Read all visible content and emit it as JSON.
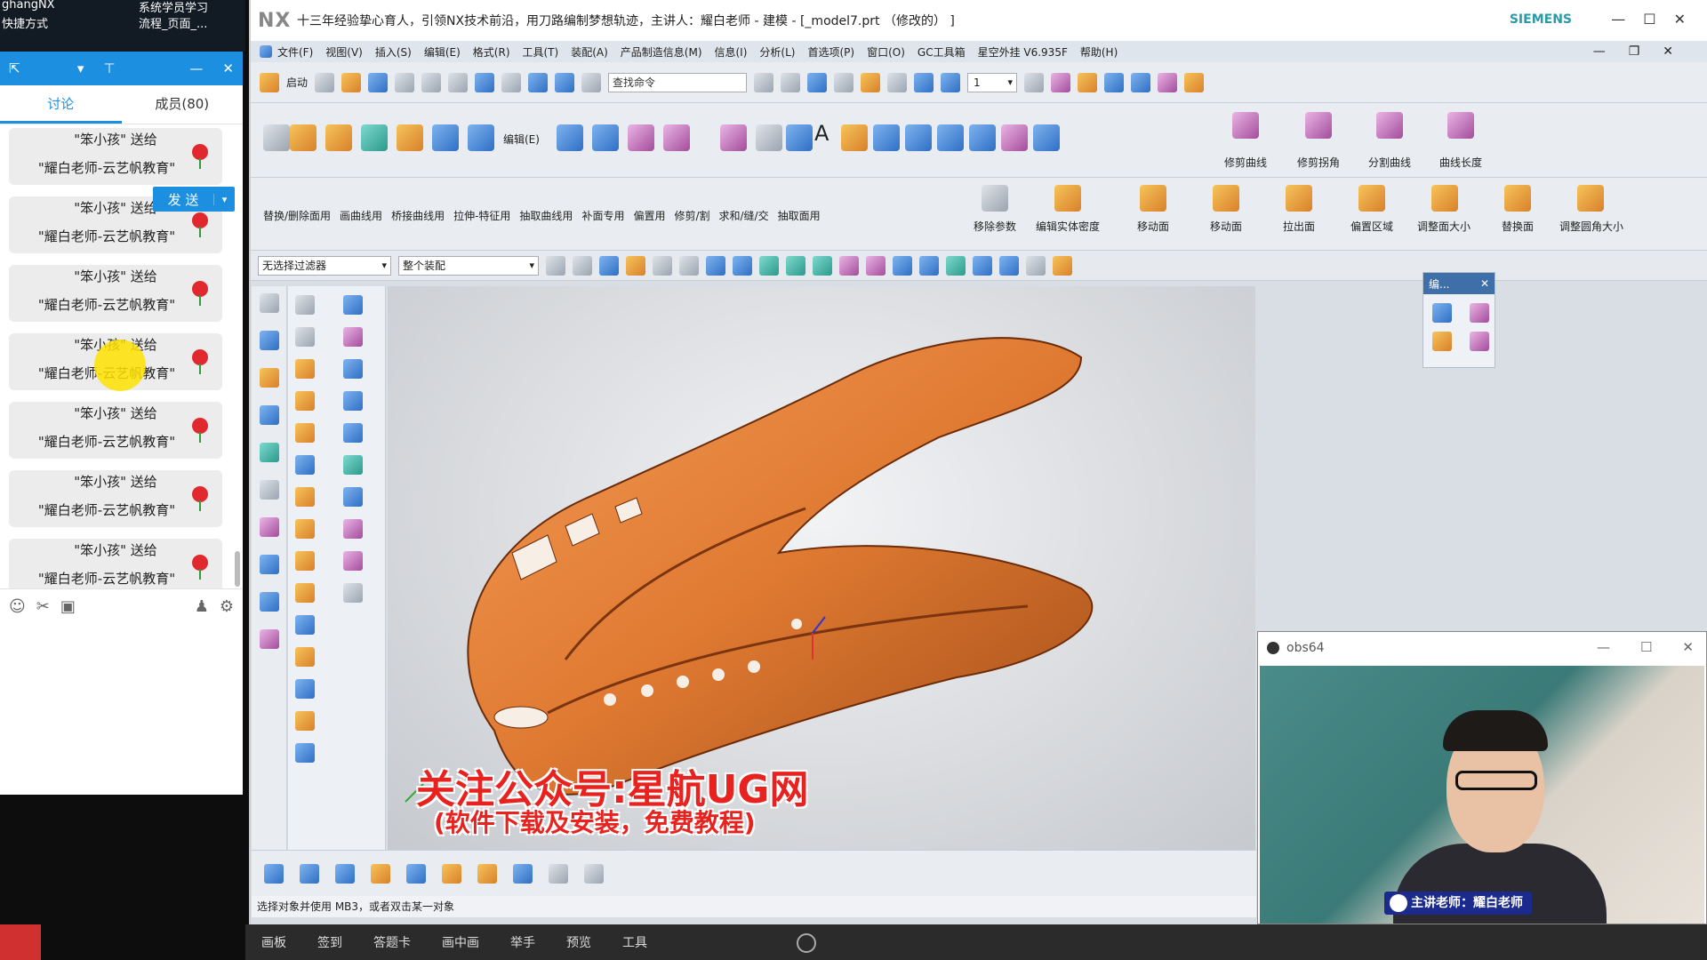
{
  "desktop": {
    "left_top": "ghangNX",
    "left_sub": "快捷方式",
    "right_top": "系统学员学习",
    "right_sub": "流程_页面_..."
  },
  "chat": {
    "tabs": [
      {
        "label": "讨论"
      },
      {
        "label": "成员(80)"
      }
    ],
    "messages": [
      {
        "line1": "\"笨小孩\" 送给",
        "line2": "\"耀白老师-云艺帆教育\""
      },
      {
        "line1": "\"笨小孩\" 送给",
        "line2": "\"耀白老师-云艺帆教育\""
      },
      {
        "line1": "\"笨小孩\" 送给",
        "line2": "\"耀白老师-云艺帆教育\""
      },
      {
        "line1": "\"笨小孩\" 送给",
        "line2": "\"耀白老师-云艺帆教育\""
      },
      {
        "line1": "\"笨小孩\" 送给",
        "line2": "\"耀白老师-云艺帆教育\""
      },
      {
        "line1": "\"笨小孩\" 送给",
        "line2": "\"耀白老师-云艺帆教育\""
      },
      {
        "line1": "\"笨小孩\" 送给",
        "line2": "\"耀白老师-云艺帆教育\""
      }
    ],
    "send": "发 送"
  },
  "nx": {
    "logo": "NX",
    "title": "十三年经验挚心育人，引领NX技术前沿，用刀路编制梦想轨迹，主讲人：耀白老师 - 建模 - [_model7.prt （修改的） ]",
    "brand": "SIEMENS",
    "menu": [
      "文件(F)",
      "视图(V)",
      "插入(S)",
      "编辑(E)",
      "格式(R)",
      "工具(T)",
      "装配(A)",
      "产品制造信息(M)",
      "信息(I)",
      "分析(L)",
      "首选项(P)",
      "窗口(O)",
      "GC工具箱",
      "星空外挂 V6.935F",
      "帮助(H)"
    ],
    "start_label": "启动",
    "search_placeholder": "查找命令",
    "layer_value": "1",
    "edit_label": "编辑(E)",
    "ribbon_right": [
      {
        "label": "修剪曲线"
      },
      {
        "label": "修剪拐角"
      },
      {
        "label": "分割曲线"
      },
      {
        "label": "曲线长度"
      }
    ],
    "row3_left": [
      "替换/删除面用",
      "画曲线用",
      "桥接曲线用",
      "拉伸-特征用",
      "抽取曲线用",
      "补面专用",
      "偏置用",
      "修剪/割",
      "求和/缝/交",
      "抽取面用"
    ],
    "row3_right": [
      {
        "label": "移除参数"
      },
      {
        "label": "编辑实体密度"
      },
      {
        "label": "移动面"
      },
      {
        "label": "移动面"
      },
      {
        "label": "拉出面"
      },
      {
        "label": "偏置区域"
      },
      {
        "label": "调整面大小"
      },
      {
        "label": "替换面"
      },
      {
        "label": "调整圆角大小"
      }
    ],
    "filter": "无选择过滤器",
    "assembly": "整个装配",
    "palette_title": "编...",
    "status": "选择对象并使用 MB3，或者双击某一对象",
    "colors": {
      "model": "#e07a32",
      "accent": "#1c8fe0",
      "watermark": "#e8231f"
    }
  },
  "watermark": {
    "line1": "关注公众号:星航UG网",
    "line2": "(软件下载及安装，免费教程)"
  },
  "obs": {
    "title": "obs64",
    "badge": "主讲老师：耀白老师"
  },
  "bottom": {
    "items": [
      "画板",
      "签到",
      "答题卡",
      "画中画",
      "举手",
      "预览",
      "工具"
    ]
  }
}
